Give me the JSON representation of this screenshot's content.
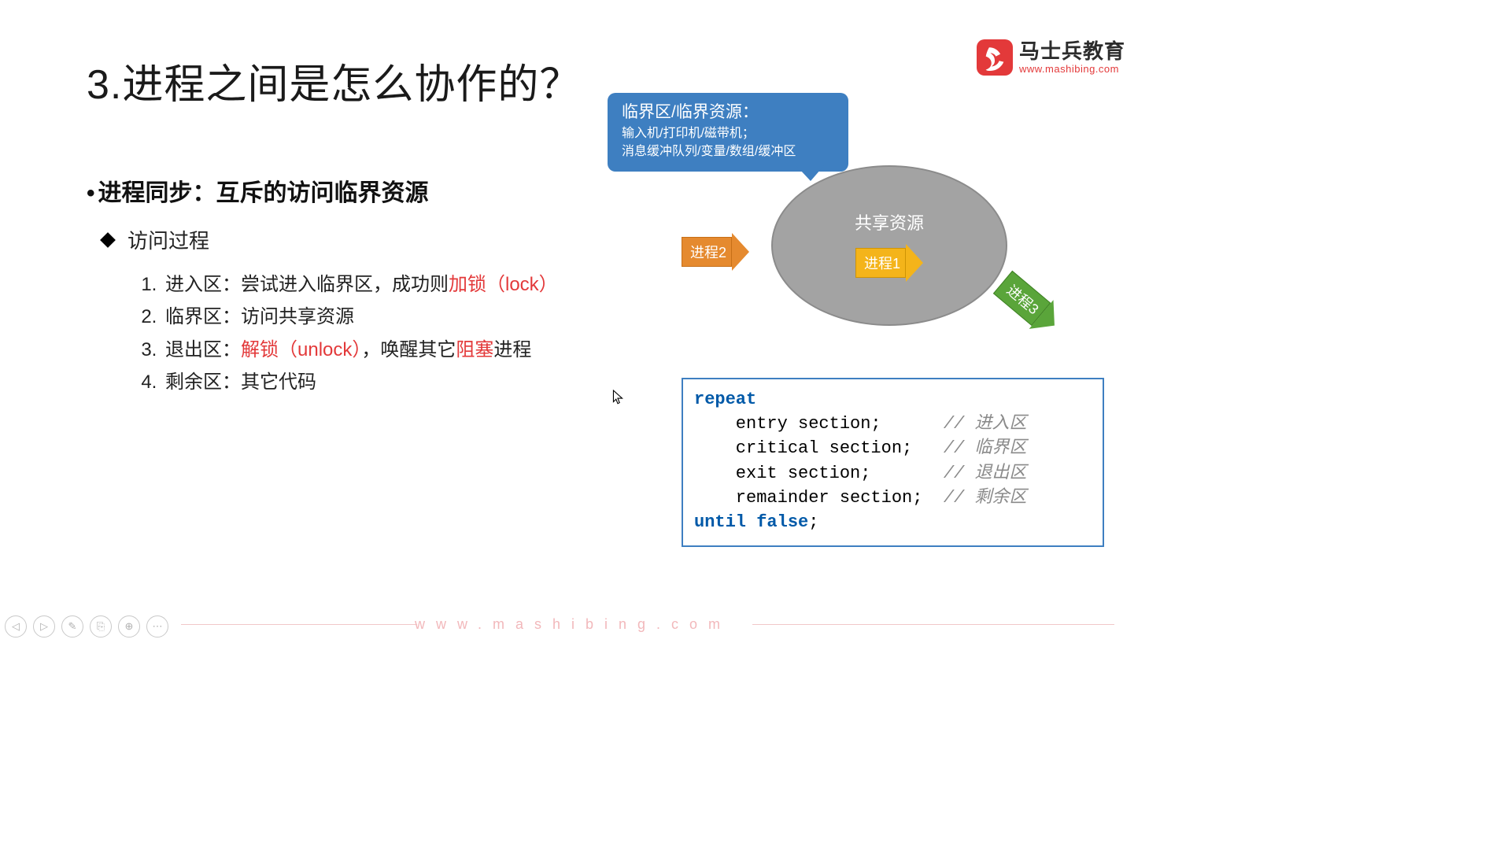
{
  "logo": {
    "cn": "马士兵教育",
    "url": "www.mashibing.com"
  },
  "title": "3.进程之间是怎么协作的？",
  "main_bullet": "进程同步：互斥的访问临界资源",
  "sub_bullet": "访问过程",
  "steps": {
    "s1a": "进入区：尝试进入临界区，成功则",
    "s1b": "加锁（lock）",
    "s2": "临界区：访问共享资源",
    "s3a": "退出区：",
    "s3b": "解锁（unlock）",
    "s3c": "，唤醒其它",
    "s3d": "阻塞",
    "s3e": "进程",
    "s4": "剩余区：其它代码"
  },
  "bubble": {
    "title": "临界区/临界资源：",
    "line1": "输入机/打印机/磁带机；",
    "line2": "消息缓冲队列/变量/数组/缓冲区"
  },
  "diagram": {
    "oval_label": "共享资源",
    "p1": "进程1",
    "p2": "进程2",
    "p3": "进程3"
  },
  "code": {
    "kw_repeat": "repeat",
    "l1": "    entry section;      ",
    "c1": "// 进入区",
    "l2": "    critical section;   ",
    "c2": "// 临界区",
    "l3": "    exit section;       ",
    "c3": "// 退出区",
    "l4": "    remainder section;  ",
    "c4": "// 剩余区",
    "kw_until": "until false",
    "semi": ";"
  },
  "footer_url": "www.mashibing.com",
  "controls": {
    "prev": "◁",
    "next": "▷",
    "pen": "✎",
    "clip": "⎘",
    "zoom": "⊕",
    "more": "⋯"
  }
}
